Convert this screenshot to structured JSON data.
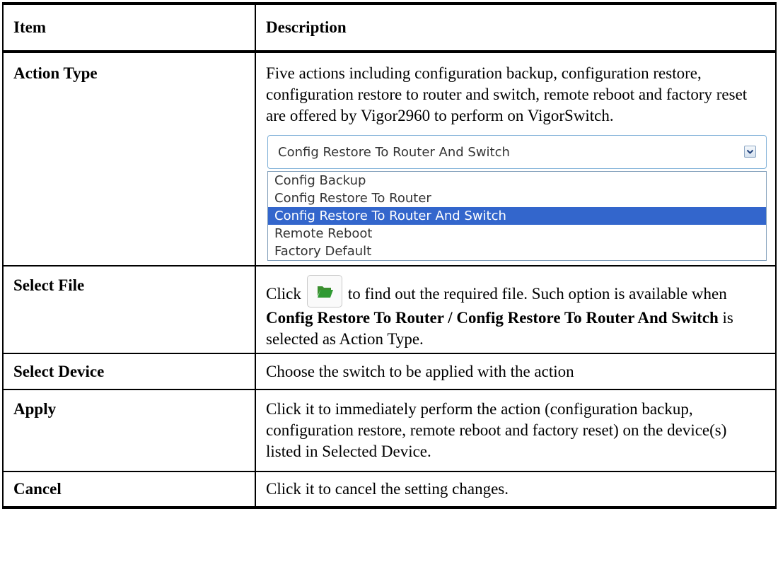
{
  "header": {
    "item": "Item",
    "description": "Description"
  },
  "rows": {
    "action_type": {
      "item": "Action Type",
      "description": "Five actions including configuration backup, configuration restore, configuration restore to router and switch, remote reboot and factory reset are offered by Vigor2960 to perform on VigorSwitch.",
      "dropdown": {
        "selected": "Config Restore To Router And Switch",
        "options": [
          "Config Backup",
          "Config Restore To Router",
          "Config Restore To Router And Switch",
          "Remote Reboot",
          "Factory Default"
        ],
        "selected_index": 2,
        "icon": "chevron-down-icon"
      }
    },
    "select_file": {
      "item": "Select File",
      "pre": "Click",
      "post": "to find out the required file. Such option is available when",
      "bold": "Config Restore To Router / Config Restore To Router And Switch",
      "tail": "is selected as Action Type.",
      "icon": "folder-open-icon"
    },
    "select_device": {
      "item": "Select Device",
      "description": "Choose the switch to be applied with the action"
    },
    "apply": {
      "item": "Apply",
      "description": "Click it to immediately perform the action (configuration backup, configuration restore, remote reboot and factory reset) on the device(s) listed in Selected Device."
    },
    "cancel": {
      "item": "Cancel",
      "description": "Click it to cancel the setting changes."
    }
  },
  "colors": {
    "selection": "#3366cc",
    "folder": "#2e8b2e",
    "dropdown_border": "#7fb0d8"
  }
}
